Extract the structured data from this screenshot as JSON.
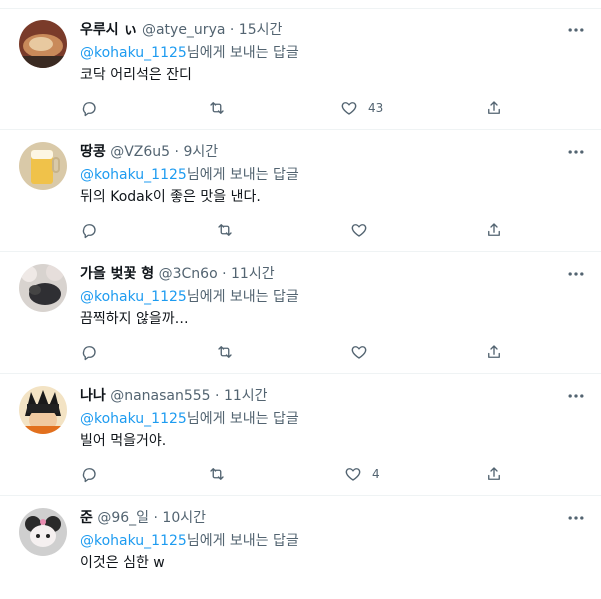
{
  "reply_to_handle": "@kohaku_1125",
  "reply_suffix": "님에게 보내는 답글",
  "separator": "·",
  "tweets": [
    {
      "name": "우루시 ぃ",
      "handle": "@atye_urya",
      "time": "15시간",
      "text": "코닥 어리석은 잔디",
      "like_count": "43"
    },
    {
      "name": "땅콩",
      "handle": "@VZ6u5",
      "time": "9시간",
      "text": "뒤의 Kodak이 좋은 맛을 낸다.",
      "like_count": ""
    },
    {
      "name": "가을 벚꽃 형",
      "handle": "@3Cn6o",
      "time": "11시간",
      "text": "끔찍하지 않을까…",
      "like_count": ""
    },
    {
      "name": "나나",
      "handle": "@nanasan555",
      "time": "11시간",
      "text": "빌어 먹을거야.",
      "like_count": "4"
    },
    {
      "name": "준",
      "handle": "@96_일",
      "time": "10시간",
      "text": "이것은 심한 w",
      "like_count": ""
    }
  ],
  "icons": {
    "more": "more-horizontal-icon",
    "reply": "reply-icon",
    "retweet": "retweet-icon",
    "like": "heart-icon",
    "share": "share-icon"
  },
  "colors": {
    "accent": "#1d9bf0",
    "secondary_text": "#536471",
    "border": "#eff3f4"
  }
}
